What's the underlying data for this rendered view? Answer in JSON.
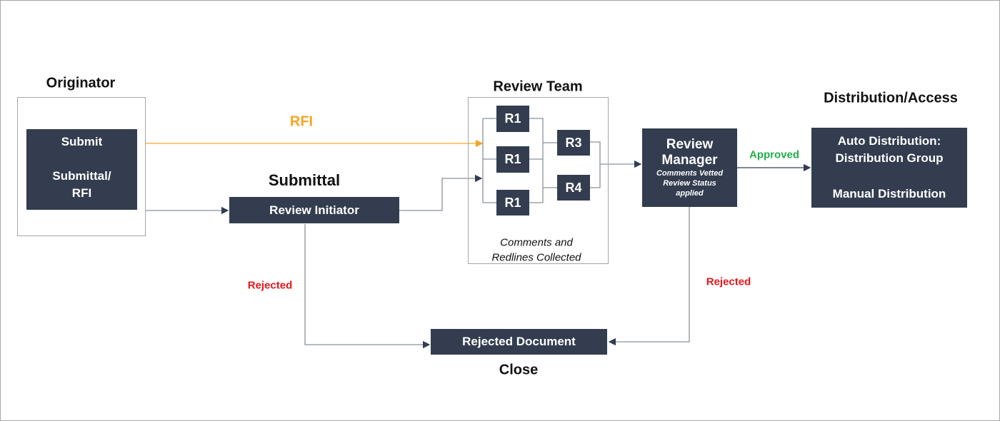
{
  "colors": {
    "box": "#333d4f",
    "rfi": "#f5a623",
    "approved": "#22b04b",
    "rejected": "#e8161b",
    "line": "#8a929c"
  },
  "originator": {
    "title": "Originator",
    "submit": "Submit",
    "line2": "Submittal/",
    "line3": "RFI"
  },
  "rfi_label": "RFI",
  "submittal": {
    "title": "Submittal",
    "initiator": "Review Initiator"
  },
  "review_team": {
    "title": "Review Team",
    "reviewers": [
      "R1",
      "R1",
      "R1",
      "R3",
      "R4"
    ],
    "note1": "Comments and",
    "note2": "Redlines Collected"
  },
  "review_manager": {
    "line1": "Review",
    "line2": "Manager",
    "note1": "Comments Vetted",
    "note2": "Review Status",
    "note3": "applied"
  },
  "approved": "Approved",
  "distribution": {
    "title": "Distribution/Access",
    "line1": "Auto Distribution:",
    "line2": "Distribution Group",
    "line3": "Manual Distribution"
  },
  "rejected_left": "Rejected",
  "rejected_right": "Rejected",
  "rejected_doc": "Rejected Document",
  "close": "Close"
}
